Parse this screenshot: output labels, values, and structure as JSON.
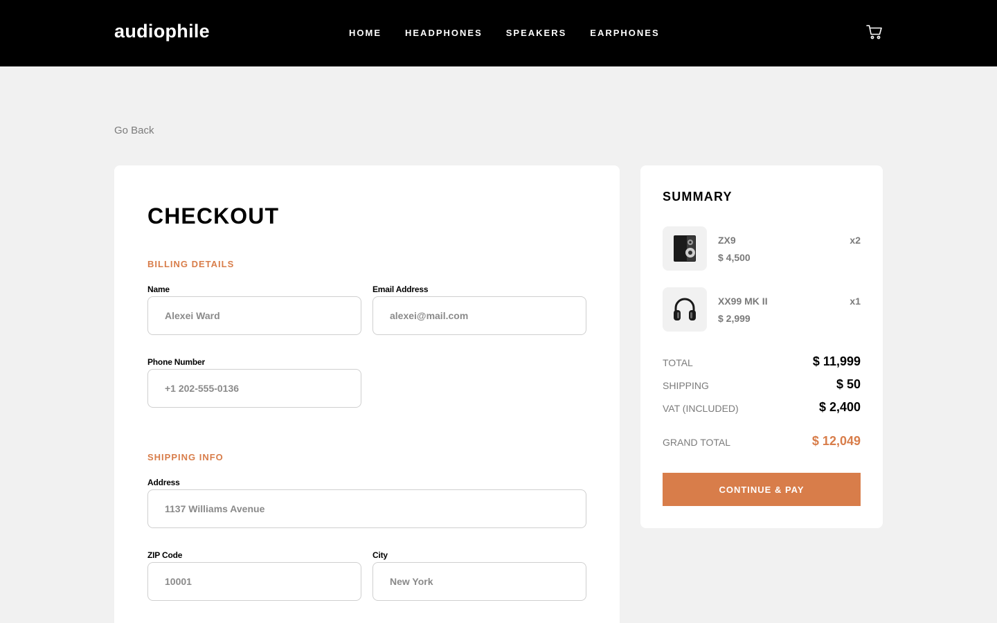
{
  "header": {
    "logo": "audiophile",
    "nav": [
      "HOME",
      "HEADPHONES",
      "SPEAKERS",
      "EARPHONES"
    ],
    "cart_icon": "cart-icon"
  },
  "go_back": "Go Back",
  "checkout": {
    "title": "CHECKOUT",
    "billing": {
      "section": "BILLING DETAILS",
      "name_label": "Name",
      "name_placeholder": "Alexei Ward",
      "email_label": "Email Address",
      "email_placeholder": "alexei@mail.com",
      "phone_label": "Phone Number",
      "phone_placeholder": "+1 202-555-0136"
    },
    "shipping": {
      "section": "SHIPPING INFO",
      "address_label": "Address",
      "address_placeholder": "1137 Williams Avenue",
      "zip_label": "ZIP Code",
      "zip_placeholder": "10001",
      "city_label": "City",
      "city_placeholder": "New York"
    }
  },
  "summary": {
    "title": "SUMMARY",
    "items": [
      {
        "name": "ZX9",
        "price": "$ 4,500",
        "qty": "x2",
        "icon": "speaker-icon"
      },
      {
        "name": "XX99 MK II",
        "price": "$ 2,999",
        "qty": "x1",
        "icon": "headphones-icon"
      }
    ],
    "total_label": "TOTAL",
    "total_value": "$ 11,999",
    "shipping_label": "SHIPPING",
    "shipping_value": "$ 50",
    "vat_label": "VAT (INCLUDED)",
    "vat_value": "$ 2,400",
    "grand_label": "GRAND TOTAL",
    "grand_value": "$ 12,049",
    "pay_button": "CONTINUE & PAY"
  },
  "colors": {
    "accent": "#d87d4a",
    "header_bg": "#000000",
    "page_bg": "#f1f1f1"
  }
}
